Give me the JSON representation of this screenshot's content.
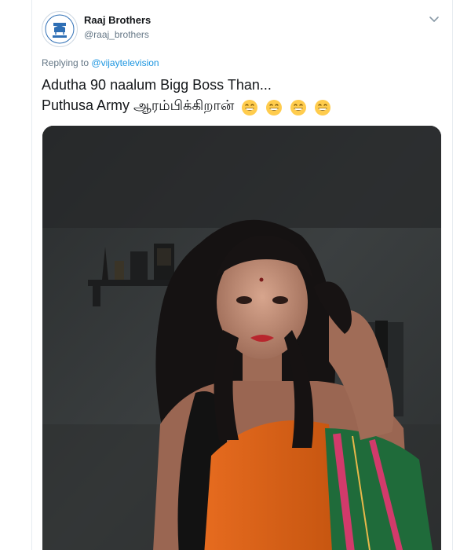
{
  "tweet": {
    "author": {
      "display_name": "Raaj Brothers",
      "handle": "@raaj_brothers",
      "avatar_icon": "raaj-brothers-logo"
    },
    "replying_to": {
      "prefix": "Replying to",
      "mention": "@vijaytelevision"
    },
    "text": {
      "line1": "Adutha 90 naalum Bigg Boss Than...",
      "line2": "Puthusa Army ஆரம்பிக்கிறான்"
    },
    "emojis": [
      "grinning-face",
      "grinning-face",
      "grinning-face",
      "grinning-face"
    ],
    "menu_icon": "chevron-down-icon"
  },
  "colors": {
    "accent": "#1b95e0",
    "secondary_text": "#657786",
    "primary_text": "#14171a",
    "border": "#e6ecf0"
  }
}
